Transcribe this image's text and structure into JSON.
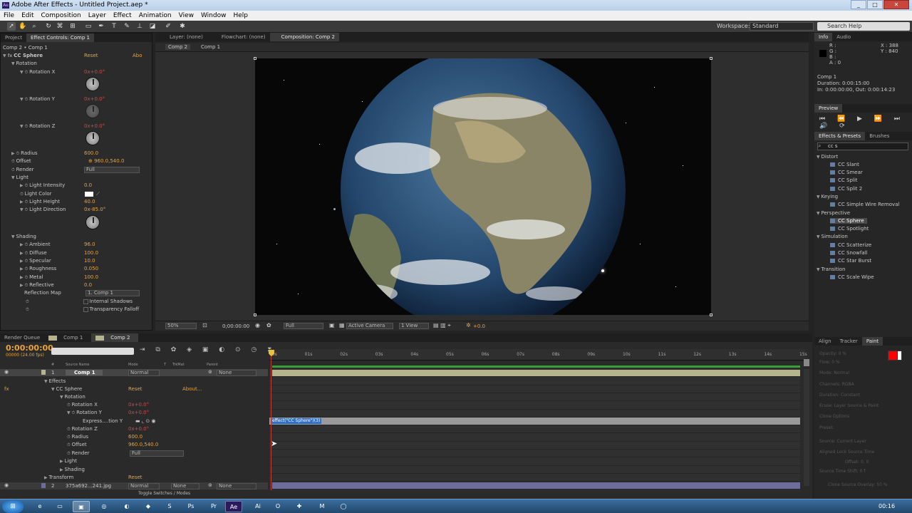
{
  "window": {
    "title": "Adobe After Effects - Untitled Project.aep *",
    "app_icon": "Ae"
  },
  "menu": [
    "File",
    "Edit",
    "Composition",
    "Layer",
    "Effect",
    "Animation",
    "View",
    "Window",
    "Help"
  ],
  "toolbar": {
    "workspace_label": "Workspace:",
    "workspace_value": "Standard",
    "search_placeholder": "Search Help"
  },
  "panel_tabs": {
    "project": "Project",
    "effect_controls": "Effect Controls: Comp 1",
    "layer": "Layer: (none)",
    "flowchart": "Flowchart: (none)",
    "composition": "Composition: Comp 2"
  },
  "effect_controls": {
    "breadcrumb": "Comp 2 • Comp 1",
    "effect_name": "CC Sphere",
    "reset": "Reset",
    "about": "Abo",
    "rotation": "Rotation",
    "rotation_x": {
      "label": "Rotation X",
      "value": "0x+0.0°"
    },
    "rotation_y": {
      "label": "Rotation Y",
      "value": "0x+0.0°"
    },
    "rotation_z": {
      "label": "Rotation Z",
      "value": "0x+0.0°"
    },
    "radius": {
      "label": "Radius",
      "value": "600.0"
    },
    "offset": {
      "label": "Offset",
      "value": "960.0,540.0"
    },
    "render": {
      "label": "Render",
      "value": "Full"
    },
    "light": "Light",
    "light_intensity": {
      "label": "Light Intensity",
      "value": "0.0"
    },
    "light_color": {
      "label": "Light Color"
    },
    "light_height": {
      "label": "Light Height",
      "value": "40.0"
    },
    "light_direction": {
      "label": "Light Direction",
      "value": "0x-85.0°"
    },
    "shading": "Shading",
    "ambient": {
      "label": "Ambient",
      "value": "96.0"
    },
    "diffuse": {
      "label": "Diffuse",
      "value": "100.0"
    },
    "specular": {
      "label": "Specular",
      "value": "10.0"
    },
    "roughness": {
      "label": "Roughness",
      "value": "0.050"
    },
    "metal": {
      "label": "Metal",
      "value": "100.0"
    },
    "reflective": {
      "label": "Reflective",
      "value": "0.0"
    },
    "reflection_map": {
      "label": "Reflection Map",
      "value": "1. Comp 1"
    },
    "internal_shadows": "Internal Shadows",
    "transparency_falloff": "Transparency Falloff"
  },
  "viewer": {
    "tabs": [
      "Comp 2",
      "Comp 1"
    ],
    "zoom": "50%",
    "timecode": "0;00:00:00",
    "resolution": "Full",
    "camera": "Active Camera",
    "views": "1 View",
    "exposure": "+0.0"
  },
  "info": {
    "tabs": [
      "Info",
      "Audio"
    ],
    "r": "R :",
    "g": "G :",
    "b": "B :",
    "a": "A : 0",
    "x": "X : 388",
    "y": "Y : 840",
    "comp": "Comp 1",
    "duration": "Duration: 0:00:15:00",
    "inout": "In: 0:00:00:00, Out: 0:00:14:23"
  },
  "preview": {
    "title": "Preview"
  },
  "effects_presets": {
    "tabs": [
      "Effects & Presets",
      "Brushes"
    ],
    "search": "cc s",
    "categories": [
      {
        "name": "Distort",
        "items": [
          "CC Slant",
          "CC Smear",
          "CC Split",
          "CC Split 2"
        ]
      },
      {
        "name": "Keying",
        "items": [
          "CC Simple Wire Removal"
        ]
      },
      {
        "name": "Perspective",
        "items": [
          "CC Sphere",
          "CC Spotlight"
        ]
      },
      {
        "name": "Simulation",
        "items": [
          "CC Scatterize",
          "CC Snowfall",
          "CC Star Burst"
        ]
      },
      {
        "name": "Transition",
        "items": [
          "CC Scale Wipe"
        ]
      }
    ]
  },
  "paint": {
    "tabs": [
      "Align",
      "Tracker",
      "Paint"
    ],
    "fields": [
      "Opacity: 0 %",
      "Flow: 0 %",
      "Mode: Normal",
      "Channels: RGBA",
      "Duration: Constant",
      "Erase: Layer Source & Paint",
      "Clone Options",
      "Preset:",
      "Source: Current Layer",
      "Aligned  Lock Source Time",
      "Offset: 0, 0",
      "Source Time Shift: 0 f",
      "Clone Source Overlay: 50 %"
    ],
    "fg_color": "#ff0000",
    "bg_color": "#ffffff"
  },
  "timeline": {
    "tabs": [
      "Render Queue",
      "Comp 1",
      "Comp 2"
    ],
    "timecode": "0:00:00:00",
    "fps": "00000 (24.00 fps)",
    "columns": [
      "#",
      "Source Name",
      "Mode",
      "T",
      "TrkMat",
      "Parent"
    ],
    "ticks": [
      "00s",
      "01s",
      "02s",
      "03s",
      "04s",
      "05s",
      "06s",
      "07s",
      "08s",
      "09s",
      "10s",
      "11s",
      "12s",
      "13s",
      "14s",
      "15s"
    ],
    "layer1": {
      "num": "1",
      "name": "Comp 1",
      "mode": "Normal",
      "parent": "None"
    },
    "effects": "Effects",
    "cc_sphere": "CC Sphere",
    "reset": "Reset",
    "about": "About...",
    "rotation": "Rotation",
    "rotation_x": "Rotation X",
    "rotation_y": "Rotation Y",
    "expression": "Express....tion Y",
    "rotation_z": "Rotation Z",
    "rot_val": "0x+0.0°",
    "radius": "Radius",
    "radius_val": "600.0",
    "offset": "Offset",
    "offset_val": "960.0,540.0",
    "render": "Render",
    "render_val": "Full",
    "light": "Light",
    "shading": "Shading",
    "transform": "Transform",
    "layer2": {
      "num": "2",
      "name": "375a692...241.jpg",
      "mode": "Normal",
      "trkmat": "None",
      "parent": "None"
    },
    "expression_text": "effect(\"CC Sphere\")(3)",
    "toggle": "Toggle Switches / Modes"
  },
  "taskbar": {
    "time": "00:16"
  }
}
